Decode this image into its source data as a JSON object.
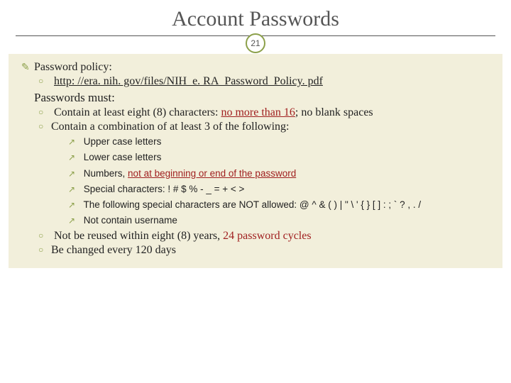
{
  "page_number": "21",
  "title": "Account Passwords",
  "policy_label": "Password policy:",
  "policy_link": "http: //era. nih. gov/files/NIH_e. RA_Password_Policy. pdf",
  "must_label": "Passwords must:",
  "rule1_a": "Contain at least eight (8) characters: ",
  "rule1_b": "no more than 16",
  "rule1_c": "; no blank spaces",
  "rule2": "Contain a combination of at least 3 of the following:",
  "sub1": "Upper case letters",
  "sub2": "Lower case letters",
  "sub3_a": "Numbers, ",
  "sub3_b": "not at beginning or end of the password",
  "sub4": "Special characters:  ! # $ % - _ = + < >",
  "sub5": "The following special characters are NOT allowed: @ ^ & ( ) | \" \\ ' { } [ ] : ; ` ? , . /",
  "sub6": "Not contain username",
  "rule3_a": "Not be reused within eight (8) years,  ",
  "rule3_b": "24 password cycles",
  "rule4": "Be changed every 120 days"
}
